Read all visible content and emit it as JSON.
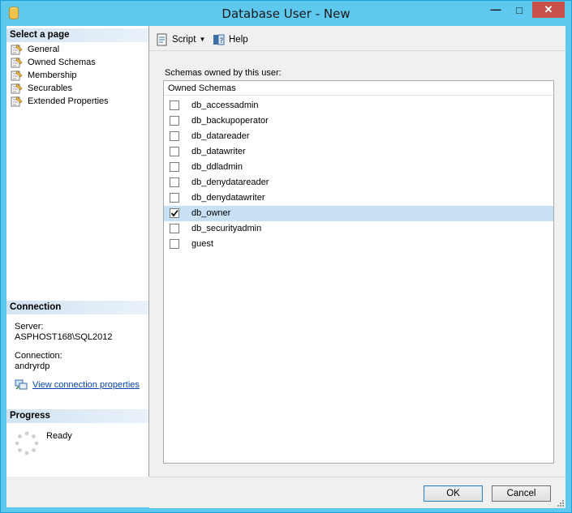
{
  "window": {
    "title": "Database User - New",
    "minimize_glyph": "—",
    "maximize_glyph": "□",
    "close_glyph": "✕"
  },
  "left_pane": {
    "select_page_header": "Select a page",
    "pages": [
      {
        "label": "General",
        "icon": "page-wrench-icon"
      },
      {
        "label": "Owned Schemas",
        "icon": "page-wrench-icon"
      },
      {
        "label": "Membership",
        "icon": "page-wrench-icon"
      },
      {
        "label": "Securables",
        "icon": "page-wrench-icon"
      },
      {
        "label": "Extended Properties",
        "icon": "page-wrench-icon"
      }
    ],
    "connection_header": "Connection",
    "server_label": "Server:",
    "server_value": "ASPHOST168\\SQL2012",
    "connection_label": "Connection:",
    "connection_value": "andryrdp",
    "view_connection_link": "View connection properties",
    "progress_header": "Progress",
    "progress_status": "Ready"
  },
  "toolbar": {
    "script_label": "Script",
    "help_label": "Help"
  },
  "schemas": {
    "section_label": "Schemas owned by this user:",
    "column_header": "Owned Schemas",
    "rows": [
      {
        "name": "db_accessadmin",
        "checked": false
      },
      {
        "name": "db_backupoperator",
        "checked": false
      },
      {
        "name": "db_datareader",
        "checked": false
      },
      {
        "name": "db_datawriter",
        "checked": false
      },
      {
        "name": "db_ddladmin",
        "checked": false
      },
      {
        "name": "db_denydatareader",
        "checked": false
      },
      {
        "name": "db_denydatawriter",
        "checked": false
      },
      {
        "name": "db_owner",
        "checked": true
      },
      {
        "name": "db_securityadmin",
        "checked": false
      },
      {
        "name": "guest",
        "checked": false
      }
    ],
    "selected_index": 7
  },
  "buttons": {
    "ok_label": "OK",
    "cancel_label": "Cancel"
  },
  "colors": {
    "titlebar": "#5ec8ee",
    "selection": "#c7e0f4",
    "close_button": "#c7504a",
    "link": "#0645ad"
  }
}
